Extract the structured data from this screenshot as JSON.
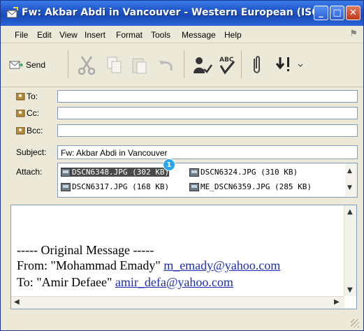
{
  "window": {
    "title": "Fw: Akbar Abdi in Vancouver - Western European (ISO)"
  },
  "menu": [
    "File",
    "Edit",
    "View",
    "Insert",
    "Format",
    "Tools",
    "Message",
    "Help"
  ],
  "toolbar": {
    "send_label": "Send"
  },
  "fields": {
    "to_label": "To:",
    "cc_label": "Cc:",
    "bcc_label": "Bcc:",
    "subject_label": "Subject:",
    "subject_value": "Fw: Akbar Abdi in Vancouver",
    "attach_label": "Attach:"
  },
  "attachments": [
    "DSCN6348.JPG (302 KB)",
    "DSCN6324.JPG (310 KB)",
    "DSCN6317.JPG (168 KB)",
    "ME_DSCN6359.JPG (285 KB)"
  ],
  "badge": "1",
  "message": {
    "divider": "----- Original Message -----",
    "from_prefix": "From: \"Mohammad Emady\"",
    "from_email": "m_emady@yahoo.com",
    "to_prefix": "To: \"Amir Defaee\"",
    "to_email": "amir_defa@yahoo.com"
  }
}
